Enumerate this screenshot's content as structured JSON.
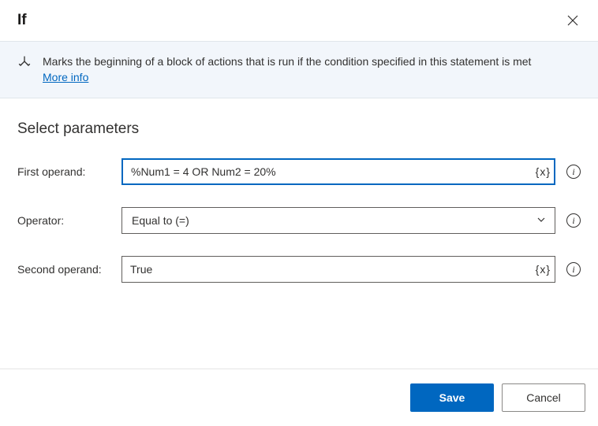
{
  "header": {
    "title": "If"
  },
  "banner": {
    "description": "Marks the beginning of a block of actions that is run if the condition specified in this statement is met",
    "more_info": "More info"
  },
  "section_title": "Select parameters",
  "fields": {
    "first_operand": {
      "label": "First operand:",
      "value": "%Num1 = 4 OR Num2 = 20%",
      "var_button": "{x}"
    },
    "operator": {
      "label": "Operator:",
      "value": "Equal to (=)"
    },
    "second_operand": {
      "label": "Second operand:",
      "value": "True",
      "var_button": "{x}"
    }
  },
  "footer": {
    "save": "Save",
    "cancel": "Cancel"
  }
}
